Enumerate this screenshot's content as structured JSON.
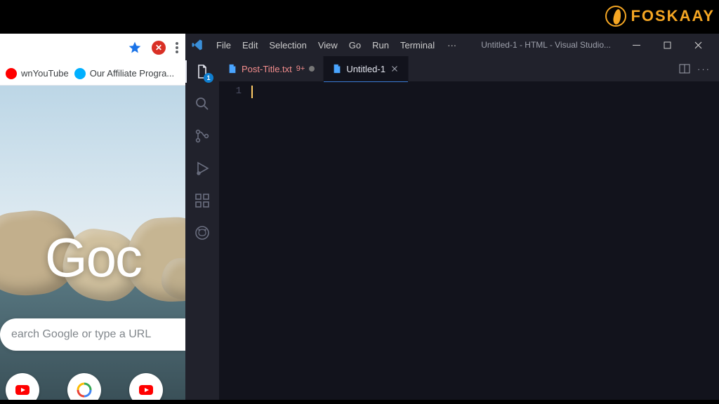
{
  "watermark": {
    "text": "FOSKAAY"
  },
  "chrome": {
    "bookmarks": [
      {
        "label": "wnYouTube",
        "iconClass": "bk-yt"
      },
      {
        "label": "Our Affiliate Progra...",
        "iconClass": "bk-aff"
      }
    ],
    "logo_fragment": "Goc",
    "search_placeholder": "earch Google or type a URL",
    "tiles": [
      "youtube",
      "google",
      "youtube"
    ]
  },
  "vscode": {
    "menu": [
      "File",
      "Edit",
      "Selection",
      "View",
      "Go",
      "Run",
      "Terminal"
    ],
    "menu_overflow": "···",
    "window_title": "Untitled-1 - HTML - Visual Studio...",
    "activity_badge": "1",
    "tabs": [
      {
        "name": "Post-Title.txt",
        "count": "9+",
        "modified": true,
        "active": false,
        "icon": "text"
      },
      {
        "name": "Untitled-1",
        "count": "",
        "modified": false,
        "active": true,
        "icon": "html"
      }
    ],
    "line_numbers": [
      "1"
    ]
  }
}
